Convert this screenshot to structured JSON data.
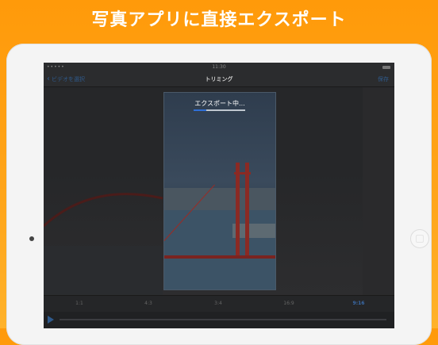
{
  "headline": "写真アプリに直接エクスポート",
  "status_bar": {
    "signal": "•••••",
    "time": "11:30"
  },
  "nav": {
    "back_label": "ビデオを選択",
    "title": "トリミング",
    "save_label": "保存"
  },
  "export": {
    "label": "エクスポート中...",
    "progress_fraction": 0.25
  },
  "ratios": [
    "1:1",
    "4:3",
    "3:4",
    "16:9",
    "9:16"
  ],
  "active_ratio": "9:16",
  "colors": {
    "background_orange": "#ff9a0a",
    "accent_blue": "#2f5a8c",
    "progress_blue": "#2f6fd6"
  }
}
